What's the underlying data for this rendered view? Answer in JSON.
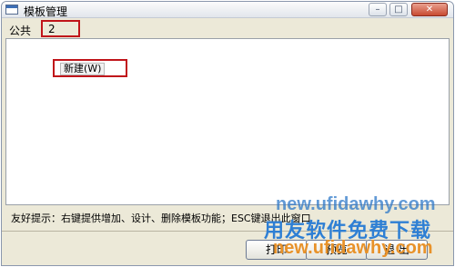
{
  "window": {
    "title": "模板管理",
    "controls": {
      "minimize": "–",
      "maximize": "□",
      "close": "✕"
    }
  },
  "tabs": {
    "label": "公共",
    "input_value": "2"
  },
  "workarea": {
    "new_item_label": "新建(W)"
  },
  "hint": "友好提示：右键提供增加、设计、删除模板功能；ESC键退出此窗口",
  "buttons": {
    "print": "打印",
    "preview": "预览",
    "exit": "退 出"
  },
  "watermark": {
    "url1": "new.ufidawhy.com",
    "cn": "用友软件免费下载",
    "url2": "new.ufidawhy.com"
  },
  "colors": {
    "highlight_border": "#c0141a",
    "watermark_blue": "#2e7fd4",
    "watermark_orange": "#e8922a"
  }
}
